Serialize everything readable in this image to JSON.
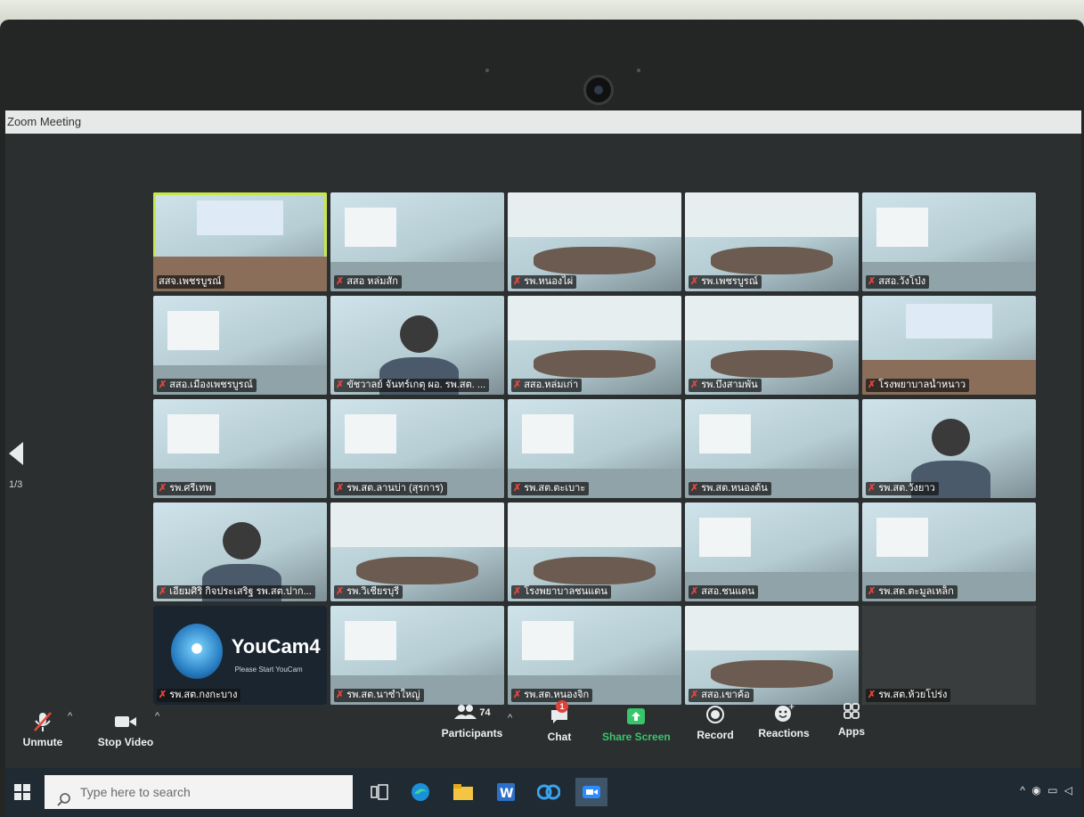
{
  "window": {
    "title": "Zoom Meeting"
  },
  "pagination": {
    "indicator": "1/3"
  },
  "participants_tiles": [
    {
      "label": "สสจ.เพชรบูรณ์",
      "active": true,
      "muted": false,
      "scene": "hall"
    },
    {
      "label": "สสอ หล่มสัก",
      "active": false,
      "muted": true,
      "scene": "office"
    },
    {
      "label": "รพ.หนองไผ่",
      "active": false,
      "muted": true,
      "scene": "meeting"
    },
    {
      "label": "รพ.เพชรบูรณ์",
      "active": false,
      "muted": true,
      "scene": "meeting"
    },
    {
      "label": "สสอ.วังโป่ง",
      "active": false,
      "muted": true,
      "scene": "office"
    },
    {
      "label": "สสอ.เมืองเพชรบูรณ์",
      "active": false,
      "muted": true,
      "scene": "office"
    },
    {
      "label": "ขัชวาลย์ จันทร์เกตุ ผอ. รพ.สต. ...",
      "active": false,
      "muted": true,
      "scene": "person"
    },
    {
      "label": "สสอ.หล่มเก่า",
      "active": false,
      "muted": true,
      "scene": "meeting"
    },
    {
      "label": "รพ.บึงสามพัน",
      "active": false,
      "muted": true,
      "scene": "meeting"
    },
    {
      "label": "โรงพยาบาลน้ำหนาว",
      "active": false,
      "muted": true,
      "scene": "hall"
    },
    {
      "label": "รพ.ศรีเทพ",
      "active": false,
      "muted": true,
      "scene": "office"
    },
    {
      "label": "รพ.สต.ลานบ่า (สุรการ)",
      "active": false,
      "muted": true,
      "scene": "office"
    },
    {
      "label": "รพ.สต.ตะเบาะ",
      "active": false,
      "muted": true,
      "scene": "office"
    },
    {
      "label": "รพ.สต.หนองต้น",
      "active": false,
      "muted": true,
      "scene": "office"
    },
    {
      "label": "รพ.สต.วังยาว",
      "active": false,
      "muted": true,
      "scene": "person"
    },
    {
      "label": "เอี่ยมศิริ กิจประเสริฐ รพ.สต.ปาก...",
      "active": false,
      "muted": true,
      "scene": "person"
    },
    {
      "label": "รพ.วิเชียรบุรี",
      "active": false,
      "muted": true,
      "scene": "meeting"
    },
    {
      "label": "โรงพยาบาลชนแดน",
      "active": false,
      "muted": true,
      "scene": "meeting"
    },
    {
      "label": "สสอ.ชนแดน",
      "active": false,
      "muted": true,
      "scene": "office"
    },
    {
      "label": "รพ.สต.ตะมูลเหล็ก",
      "active": false,
      "muted": true,
      "scene": "office"
    },
    {
      "label": "รพ.สต.กงกะบาง",
      "active": false,
      "muted": true,
      "scene": "youcam"
    },
    {
      "label": "รพ.สต.นาซำใหญ่",
      "active": false,
      "muted": true,
      "scene": "office"
    },
    {
      "label": "รพ.สต.หนองจิก",
      "active": false,
      "muted": true,
      "scene": "office"
    },
    {
      "label": "สสอ.เขาค้อ",
      "active": false,
      "muted": true,
      "scene": "meeting"
    },
    {
      "label": "รพ.สต.ห้วยโปร่ง",
      "active": false,
      "muted": true,
      "scene": "dark"
    }
  ],
  "youcam": {
    "brand": "YouCam4",
    "tagline": "Please Start YouCam"
  },
  "toolbar": {
    "unmute": "Unmute",
    "stop_video": "Stop Video",
    "participants": "Participants",
    "participants_count": "74",
    "chat": "Chat",
    "chat_badge": "1",
    "share_screen": "Share Screen",
    "record": "Record",
    "reactions": "Reactions",
    "apps": "Apps"
  },
  "taskbar": {
    "search_placeholder": "Type here to search",
    "apps": [
      "task-view",
      "edge",
      "file-explorer",
      "word",
      "app-blue",
      "zoom"
    ]
  },
  "colors": {
    "active_speaker": "#c7e84a",
    "share_green": "#38c66a",
    "muted_red": "#e5463e"
  }
}
